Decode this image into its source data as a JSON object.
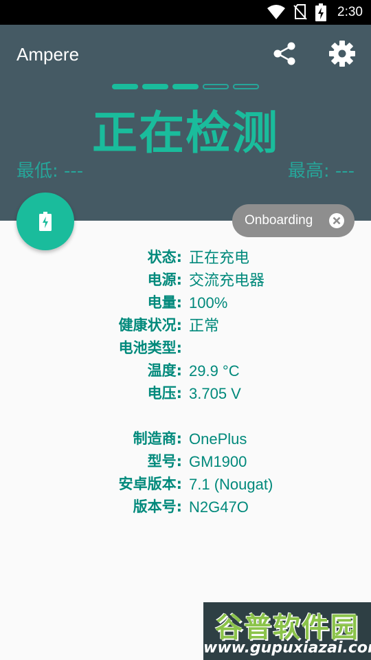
{
  "status_bar": {
    "time": "2:30",
    "icons": [
      "wifi-icon",
      "no-sim-icon",
      "battery-charging-icon"
    ]
  },
  "app": {
    "title": "Ampere",
    "icons": [
      "share-icon",
      "gear-icon"
    ]
  },
  "progress": {
    "filled": 3,
    "total": 5
  },
  "current": {
    "status": "正在检测",
    "min_label": "最低: ---",
    "max_label": "最高: ---"
  },
  "fab": {
    "icon": "battery-bolt-icon"
  },
  "onboarding": {
    "label": "Onboarding",
    "icon": "close-circle-icon"
  },
  "battery_info": [
    {
      "key": "状态:",
      "value": "正在充电"
    },
    {
      "key": "电源:",
      "value": "交流充电器"
    },
    {
      "key": "电量:",
      "value": "100%"
    },
    {
      "key": "健康状况:",
      "value": "正常"
    },
    {
      "key": "电池类型:",
      "value": ""
    },
    {
      "key": "温度:",
      "value": "29.9 °C"
    },
    {
      "key": "电压:",
      "value": "3.705 V"
    }
  ],
  "device_info": [
    {
      "key": "制造商:",
      "value": "OnePlus"
    },
    {
      "key": "型号:",
      "value": "GM1900"
    },
    {
      "key": "安卓版本:",
      "value": "7.1 (Nougat)"
    },
    {
      "key": "版本号:",
      "value": "N2G47O"
    }
  ],
  "watermark": {
    "name": "谷普软件园",
    "url": "www.gupuxiazai.com"
  },
  "colors": {
    "header": "#455a64",
    "accent": "#1abc9c",
    "text_teal": "#00897b",
    "chip": "#8e8e8e"
  }
}
